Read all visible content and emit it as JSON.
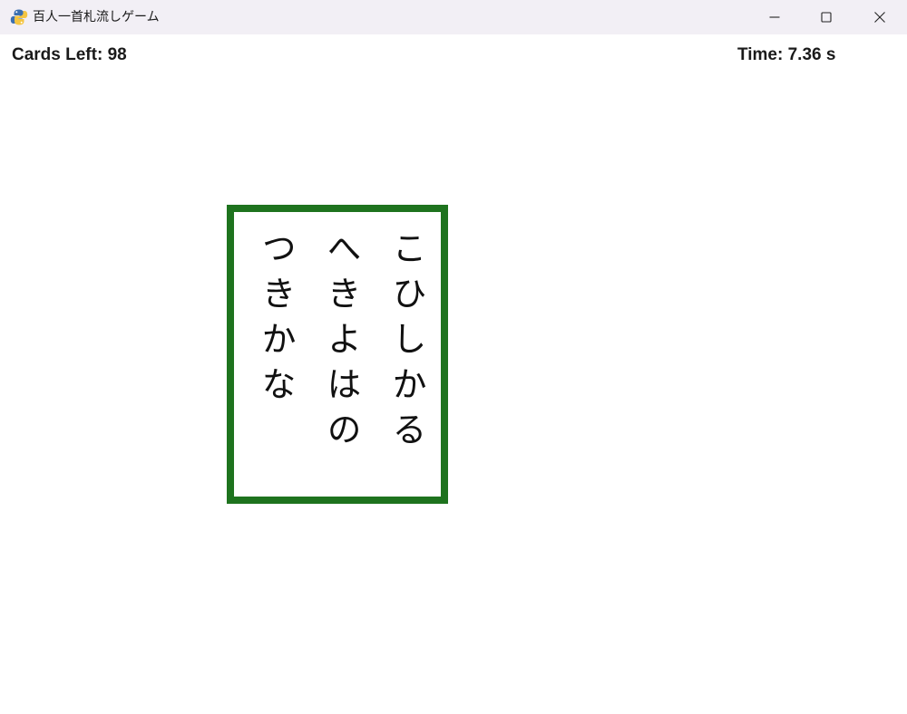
{
  "window": {
    "title": "百人一首札流しゲーム"
  },
  "hud": {
    "cards_left": "Cards Left: 98",
    "time": "Time: 7.36 s"
  },
  "card": {
    "border_color": "#1e731e",
    "columns": [
      "こひしかる",
      "へきよはの",
      "つきかな"
    ]
  }
}
